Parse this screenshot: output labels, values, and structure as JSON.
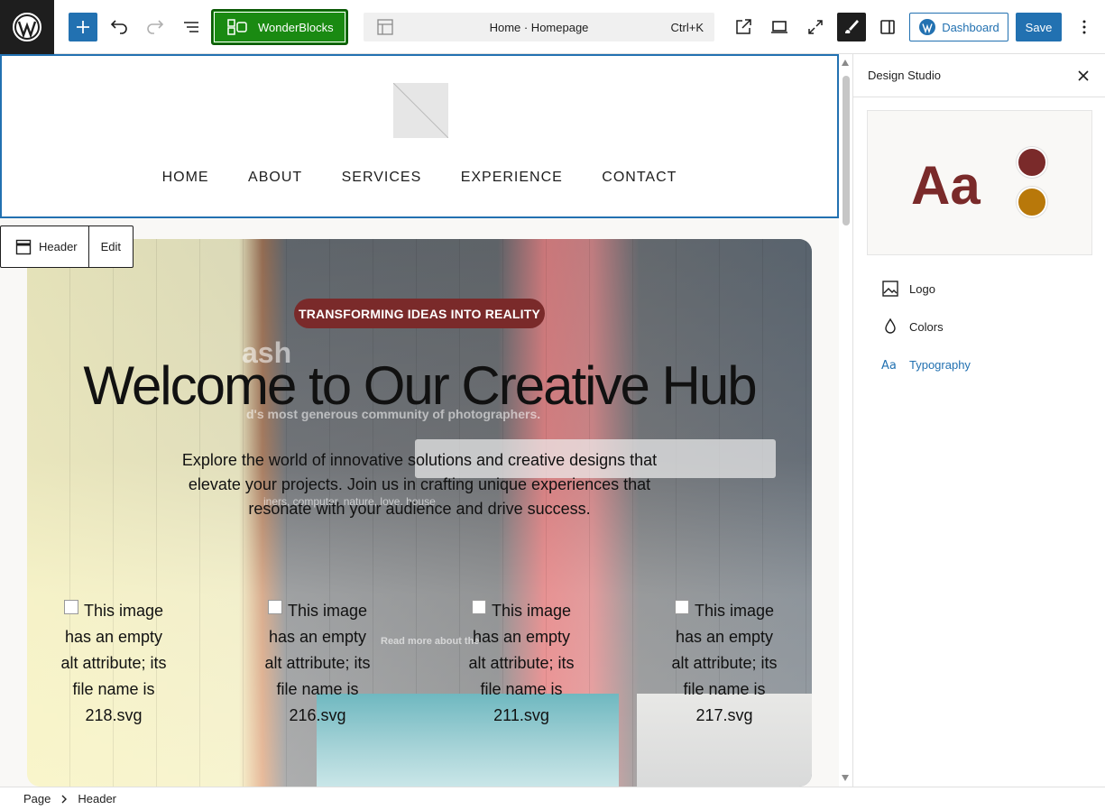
{
  "toolbar": {
    "wonderblocks_label": "WonderBlocks",
    "document_title": "Home · Homepage",
    "shortcut": "Ctrl+K",
    "dashboard_label": "Dashboard",
    "save_label": "Save"
  },
  "header": {
    "nav": [
      "HOME",
      "ABOUT",
      "SERVICES",
      "EXPERIENCE",
      "CONTACT"
    ],
    "block_toolbar": {
      "block_label": "Header",
      "edit_label": "Edit"
    }
  },
  "hero": {
    "pill": "TRANSFORMING IDEAS INTO REALITY",
    "title": "Welcome to Our Creative Hub",
    "description": "Explore the world of innovative solutions and creative designs that elevate your projects. Join us in crafting unique experiences that resonate with your audience and drive success.",
    "background_fragments": {
      "brand": "ash",
      "tagline": "d's most generous community of photographers.",
      "tags": "iners, computer, nature, love, house",
      "link": "Read more about the"
    },
    "images": [
      {
        "alt": "This image has an empty alt attribute; its file name is 218.svg"
      },
      {
        "alt": "This image has an empty alt attribute; its file name is 216.svg"
      },
      {
        "alt": "This image has an empty alt attribute; its file name is 211.svg"
      },
      {
        "alt": "This image has an empty alt attribute; its file name is 217.svg"
      }
    ]
  },
  "sidebar": {
    "title": "Design Studio",
    "preview_text": "Aa",
    "items": [
      {
        "label": "Logo",
        "icon": "image-icon"
      },
      {
        "label": "Colors",
        "icon": "droplet-icon"
      },
      {
        "label": "Typography",
        "icon": "typography-icon"
      }
    ],
    "colors": {
      "primary": "#7a2a2a",
      "secondary": "#b8780a"
    }
  },
  "breadcrumb": [
    "Page",
    "Header"
  ],
  "colors": {
    "accent": "#2271b1",
    "wonderblocks": "#1a8a12"
  }
}
